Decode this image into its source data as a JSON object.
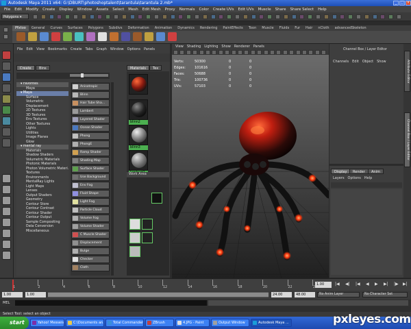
{
  "window": {
    "title": "Autodesk Maya 2011 x64: G:\\DBURT\\photoshoptalent\\tarantula\\tarantula 2.mb*"
  },
  "menubar": [
    "File",
    "Edit",
    "Modify",
    "Create",
    "Display",
    "Window",
    "Assets",
    "Select",
    "Mesh",
    "Edit Mesh",
    "Proxy",
    "Normals",
    "Color",
    "Create UVs",
    "Edit UVs",
    "Muscle",
    "Share",
    "Share Select",
    "Help"
  ],
  "statusline": {
    "mode": "Polygons"
  },
  "shelf": {
    "tabs": [
      "Pfxtoo",
      "General",
      "Curves",
      "Surfaces",
      "Polygons",
      "Subdivs",
      "Deformation",
      "Animation",
      "Dynamics",
      "Rendering",
      "PaintEffects",
      "Toon",
      "Muscle",
      "Fluids",
      "Fur",
      "Hair",
      "nCloth",
      "advancedSkeleton"
    ],
    "active": 0
  },
  "hypershade": {
    "menus": [
      "File",
      "Edit",
      "View",
      "Bookmarks",
      "Create",
      "Tabs",
      "Graph",
      "Window",
      "Options",
      "Panels"
    ],
    "left_tabs": [
      "Create",
      "Bins"
    ],
    "top_tabs": [
      "Materials",
      "Tex"
    ],
    "tree": [
      {
        "label": "Favorites",
        "header": true
      },
      {
        "label": "Maya"
      },
      {
        "label": "Maya",
        "header": true,
        "sel": true
      },
      {
        "label": "Surface"
      },
      {
        "label": "Volumetric"
      },
      {
        "label": "Displacement"
      },
      {
        "label": "2D Textures"
      },
      {
        "label": "3D Textures"
      },
      {
        "label": "Env Textures"
      },
      {
        "label": "Other Textures"
      },
      {
        "label": "Lights"
      },
      {
        "label": "Utilities"
      },
      {
        "label": "Image Planes"
      },
      {
        "label": "Glow"
      },
      {
        "label": "mental ray",
        "header": true
      },
      {
        "label": "Materials"
      },
      {
        "label": "Shadow Shaders"
      },
      {
        "label": "Volumetric Materials"
      },
      {
        "label": "Photonic Materials"
      },
      {
        "label": "Photon Volumetric Materi..."
      },
      {
        "label": "Textures"
      },
      {
        "label": "Environments"
      },
      {
        "label": "MentalRay Lights"
      },
      {
        "label": "Light Maps"
      },
      {
        "label": "Lenses"
      },
      {
        "label": "Output Shaders"
      },
      {
        "label": "Geometry"
      },
      {
        "label": "Contour Store"
      },
      {
        "label": "Contour Contrast"
      },
      {
        "label": "Contour Shader"
      },
      {
        "label": "Contour Output"
      },
      {
        "label": "Sample Compositing"
      },
      {
        "label": "Data Conversion"
      },
      {
        "label": "Miscellaneous"
      }
    ],
    "nodes": [
      {
        "label": "Anisotropic",
        "color": "#d0d0d0"
      },
      {
        "label": "Blinn",
        "color": "#b8b8b8"
      },
      {
        "label": "Hair Tube Sha...",
        "color": "#c89060"
      },
      {
        "label": "Lambert",
        "color": "#9a9a9a"
      },
      {
        "label": "Layered Shader",
        "color": "#a0a0b8"
      },
      {
        "label": "Ocean Shader",
        "color": "#4a78c0"
      },
      {
        "label": "Phong",
        "color": "#c0c0c0"
      },
      {
        "label": "PhongE",
        "color": "#b0b0b0"
      },
      {
        "label": "Ramp Shader",
        "color": "#d0a050"
      },
      {
        "label": "Shading Map",
        "color": "#808080"
      },
      {
        "label": "Surface Shader",
        "color": "#5fa04f"
      },
      {
        "label": "Use Background",
        "color": "#707070"
      },
      {
        "label": "Env Fog",
        "color": "#c0c0d0"
      },
      {
        "label": "Fluid Shape",
        "color": "#9090e0"
      },
      {
        "label": "Light Fog",
        "color": "#e0e0a0"
      },
      {
        "label": "Particle Cloud",
        "color": "#c0c0c0"
      },
      {
        "label": "Volume Fog",
        "color": "#b0b0b0"
      },
      {
        "label": "Volume Shader",
        "color": "#a0a0a0"
      },
      {
        "label": "C Muscle Shader",
        "color": "#d05050"
      },
      {
        "label": "Displacement",
        "color": "#909090"
      },
      {
        "label": "Bulge",
        "color": "#b0b0b0"
      },
      {
        "label": "Checker",
        "color": "#e0e0e0"
      },
      {
        "label": "Cloth",
        "color": "#a08060"
      }
    ],
    "swatches": [
      {
        "label": "",
        "style": "red"
      },
      {
        "label": "blinn2",
        "style": "dark"
      },
      {
        "label": "blinn3",
        "style": "grey"
      },
      {
        "label": "lambert1",
        "style": "grey2"
      }
    ],
    "work_area_label": "Work Area"
  },
  "viewport": {
    "menus": [
      "View",
      "Shading",
      "Lighting",
      "Show",
      "Renderer",
      "Panels"
    ],
    "hud": [
      {
        "label": "Verts:",
        "a": "50300",
        "b": "0",
        "c": "0"
      },
      {
        "label": "Edges:",
        "a": "101616",
        "b": "0",
        "c": "0"
      },
      {
        "label": "Faces:",
        "a": "50688",
        "b": "0",
        "c": "0"
      },
      {
        "label": "Tris:",
        "a": "100736",
        "b": "0",
        "c": "0"
      },
      {
        "label": "UVs:",
        "a": "57103",
        "b": "0",
        "c": "0"
      }
    ]
  },
  "channelbox": {
    "title": "Channel Box / Layer Editor",
    "menus": [
      "Channels",
      "Edit",
      "Object",
      "Show"
    ]
  },
  "layers": {
    "tabs": [
      "Display",
      "Render",
      "Anim"
    ],
    "menus": [
      "Layers",
      "Options",
      "Help"
    ]
  },
  "sidetabs": [
    "Attribute Editor",
    "Channel Box / Layer Editor"
  ],
  "timeslider": {
    "ticks": [
      "1",
      "2",
      "4",
      "6",
      "8",
      "10",
      "12",
      "14",
      "16",
      "18",
      "20",
      "22",
      "24"
    ],
    "current": "1.00"
  },
  "rangeslider": {
    "start": "1.00",
    "inner_start": "1.00",
    "inner_end": "24.00",
    "end": "48.00",
    "anim_layer": "No Anim Layer",
    "char_set": "No Character Set"
  },
  "cmdline": {
    "label": "MEL"
  },
  "helpline": {
    "text": "Select Tool: select an object"
  },
  "taskbar": {
    "start": "start",
    "items": [
      {
        "label": "Yahoo! Messenger",
        "color": "#7b2fa8"
      },
      {
        "label": "C:\\Documents an...",
        "color": "#e8c84a"
      },
      {
        "label": "Total Commander ...",
        "color": "#3a8fd8"
      },
      {
        "label": "ZBrush",
        "color": "#c04040"
      },
      {
        "label": "4.JPG - Paint",
        "color": "#e0e0e0"
      },
      {
        "label": "Output Window",
        "color": "#a0a0a0"
      },
      {
        "label": "Autodesk Maya ...",
        "color": "#1a9dd8",
        "active": true
      }
    ]
  },
  "watermark": "pxleyes.com"
}
